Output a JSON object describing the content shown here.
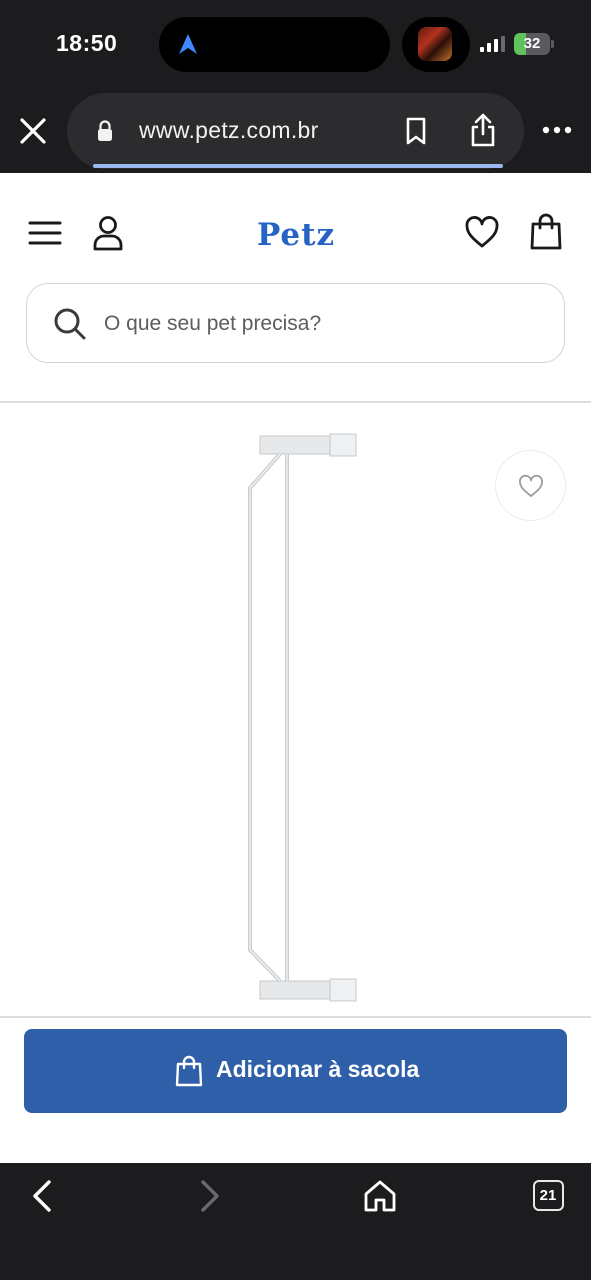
{
  "status_bar": {
    "time": "18:50",
    "battery_percent": 32,
    "battery_label": "32"
  },
  "browser": {
    "url": "www.petz.com.br",
    "icons": [
      "close-icon",
      "lock-icon",
      "bookmark-icon",
      "share-icon",
      "more-icon"
    ],
    "tabs_count": "21"
  },
  "header": {
    "logo_text": "Petz",
    "icons": [
      "menu-icon",
      "user-icon",
      "heart-icon",
      "bag-icon"
    ]
  },
  "search": {
    "placeholder": "O que seu pet precisa?"
  },
  "product": {
    "image_alt_icon": "pet-gate-extension",
    "favorite_icon": "heart-icon"
  },
  "cta": {
    "label": "Adicionar à sacola"
  },
  "colors": {
    "brand_blue": "#2e5fa8",
    "logo_blue": "#2763c4",
    "dark_bar": "#1c1c1e",
    "battery_green": "#5fc25d"
  }
}
